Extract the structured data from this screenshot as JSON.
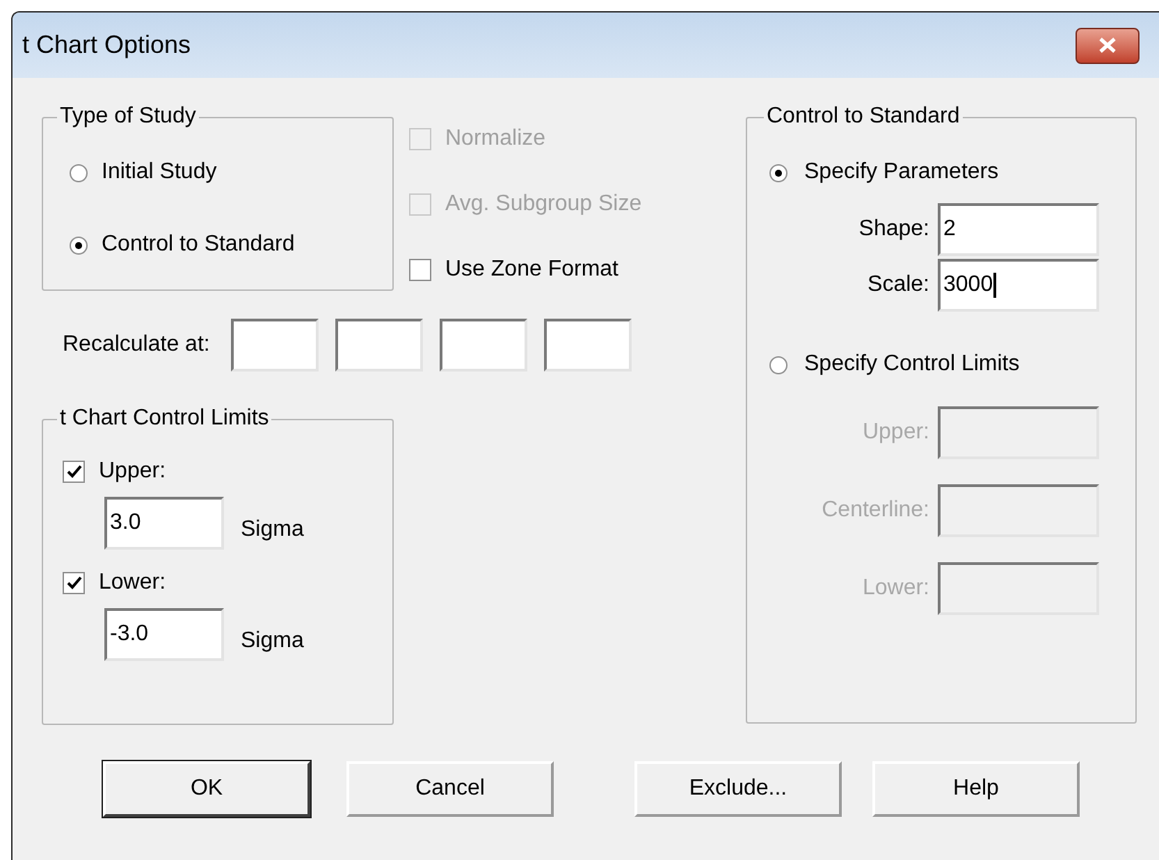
{
  "window": {
    "title": "t Chart Options"
  },
  "type_of_study": {
    "title": "Type of Study",
    "options": [
      {
        "label": "Initial Study",
        "selected": false
      },
      {
        "label": "Control to Standard",
        "selected": true
      }
    ]
  },
  "options": [
    {
      "label": "Normalize",
      "checked": false,
      "disabled": true
    },
    {
      "label": "Avg. Subgroup Size",
      "checked": false,
      "disabled": true
    },
    {
      "label": "Use Zone Format",
      "checked": false,
      "disabled": false
    }
  ],
  "recalculate": {
    "label": "Recalculate at:"
  },
  "limits": {
    "title": "t Chart Control Limits",
    "items": [
      {
        "label": "Upper:",
        "checked": true,
        "value": "3.0",
        "unit": "Sigma"
      },
      {
        "label": "Lower:",
        "checked": true,
        "value": "-3.0",
        "unit": "Sigma"
      }
    ]
  },
  "control": {
    "title": "Control to Standard",
    "modes": [
      {
        "label": "Specify Parameters",
        "selected": true,
        "fields": [
          {
            "label": "Shape:",
            "value": "2",
            "disabled": false,
            "focused": false
          },
          {
            "label": "Scale:",
            "value": "3000",
            "disabled": false,
            "focused": true
          }
        ]
      },
      {
        "label": "Specify Control Limits",
        "selected": false,
        "fields": [
          {
            "label": "Upper:",
            "disabled": true,
            "focused": false
          },
          {
            "label": "Centerline:",
            "disabled": true,
            "focused": false
          },
          {
            "label": "Lower:",
            "disabled": true,
            "focused": false
          }
        ]
      }
    ]
  },
  "buttons": [
    {
      "label": "OK",
      "default": true
    },
    {
      "label": "Cancel",
      "default": false
    },
    {
      "label": "Exclude...",
      "default": false
    },
    {
      "label": "Help",
      "default": false
    }
  ]
}
